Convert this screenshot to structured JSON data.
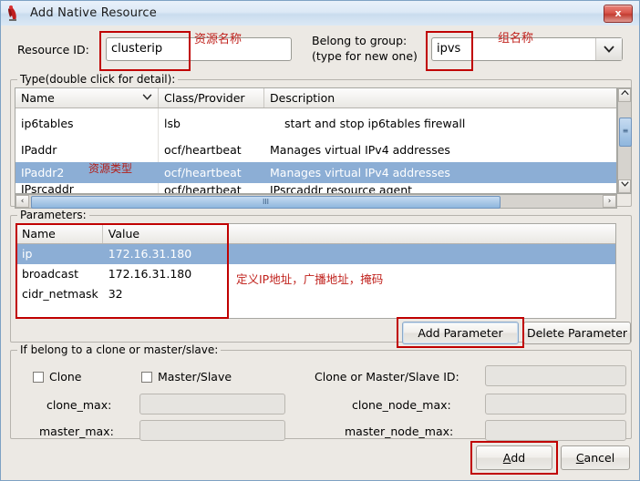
{
  "window": {
    "title": "Add Native Resource",
    "icon": "app-icon",
    "close_label": "x"
  },
  "form": {
    "resource_id_label": "Resource ID:",
    "resource_id_value": "clusterip",
    "belong_group_label_line1": "Belong to group:",
    "belong_group_label_line2": "(type for new one)",
    "belong_group_value": "ipvs",
    "combo_arrow": "⌄"
  },
  "type_section": {
    "title": "Type(double click for detail):",
    "columns": [
      "Name",
      "Class/Provider",
      "Description"
    ],
    "sort_indicator": "⌄",
    "rows": [
      {
        "name": "ip6tables",
        "class": "lsb",
        "description": "start and stop ip6tables firewall",
        "selected": false
      },
      {
        "name": "IPaddr",
        "class": "ocf/heartbeat",
        "description": "Manages virtual IPv4 addresses",
        "selected": false
      },
      {
        "name": "IPaddr2",
        "class": "ocf/heartbeat",
        "description": "Manages virtual IPv4 addresses",
        "selected": true
      },
      {
        "name": "IPsrcaddr",
        "class": "ocf/heartbeat",
        "description": "IPsrcaddr resource agent",
        "selected": false
      }
    ],
    "vscroll": {
      "up": "⌃",
      "down": "⌄",
      "grip": "≡"
    },
    "hscroll": {
      "left": "‹",
      "right": "›",
      "grip": "III"
    }
  },
  "parameters_section": {
    "title": "Parameters:",
    "columns": [
      "Name",
      "Value"
    ],
    "rows": [
      {
        "name": "ip",
        "value": "172.16.31.180",
        "selected": true
      },
      {
        "name": "broadcast",
        "value": "172.16.31.180",
        "selected": false
      },
      {
        "name": "cidr_netmask",
        "value": "32",
        "selected": false
      }
    ],
    "add_parameter_label": "Add Parameter",
    "delete_parameter_label": "Delete Parameter"
  },
  "clone_section": {
    "title": "If belong to a clone or master/slave:",
    "clone_label": "Clone",
    "master_slave_label": "Master/Slave",
    "clone_checked": false,
    "master_slave_checked": false,
    "clone_or_ms_id_label": "Clone or Master/Slave ID:",
    "clone_or_ms_id_value": "",
    "clone_max_label": "clone_max:",
    "clone_max_value": "",
    "clone_node_max_label": "clone_node_max:",
    "clone_node_max_value": "",
    "master_max_label": "master_max:",
    "master_max_value": "",
    "master_node_max_label": "master_node_max:",
    "master_node_max_value": ""
  },
  "footer": {
    "add_mnemonic": "A",
    "add_rest": "dd",
    "cancel_mnemonic": "C",
    "cancel_rest": "ancel"
  },
  "annotations": {
    "resource_name": "资源名称",
    "group_name": "组名称",
    "resource_type": "资源类型",
    "ip_desc": "定义IP地址，广播地址，掩码"
  },
  "colors": {
    "annotation_red": "#c0211c",
    "box_red": "#c00000",
    "selection_blue": "#8caed5",
    "window_chrome": "#c3d9ef"
  }
}
